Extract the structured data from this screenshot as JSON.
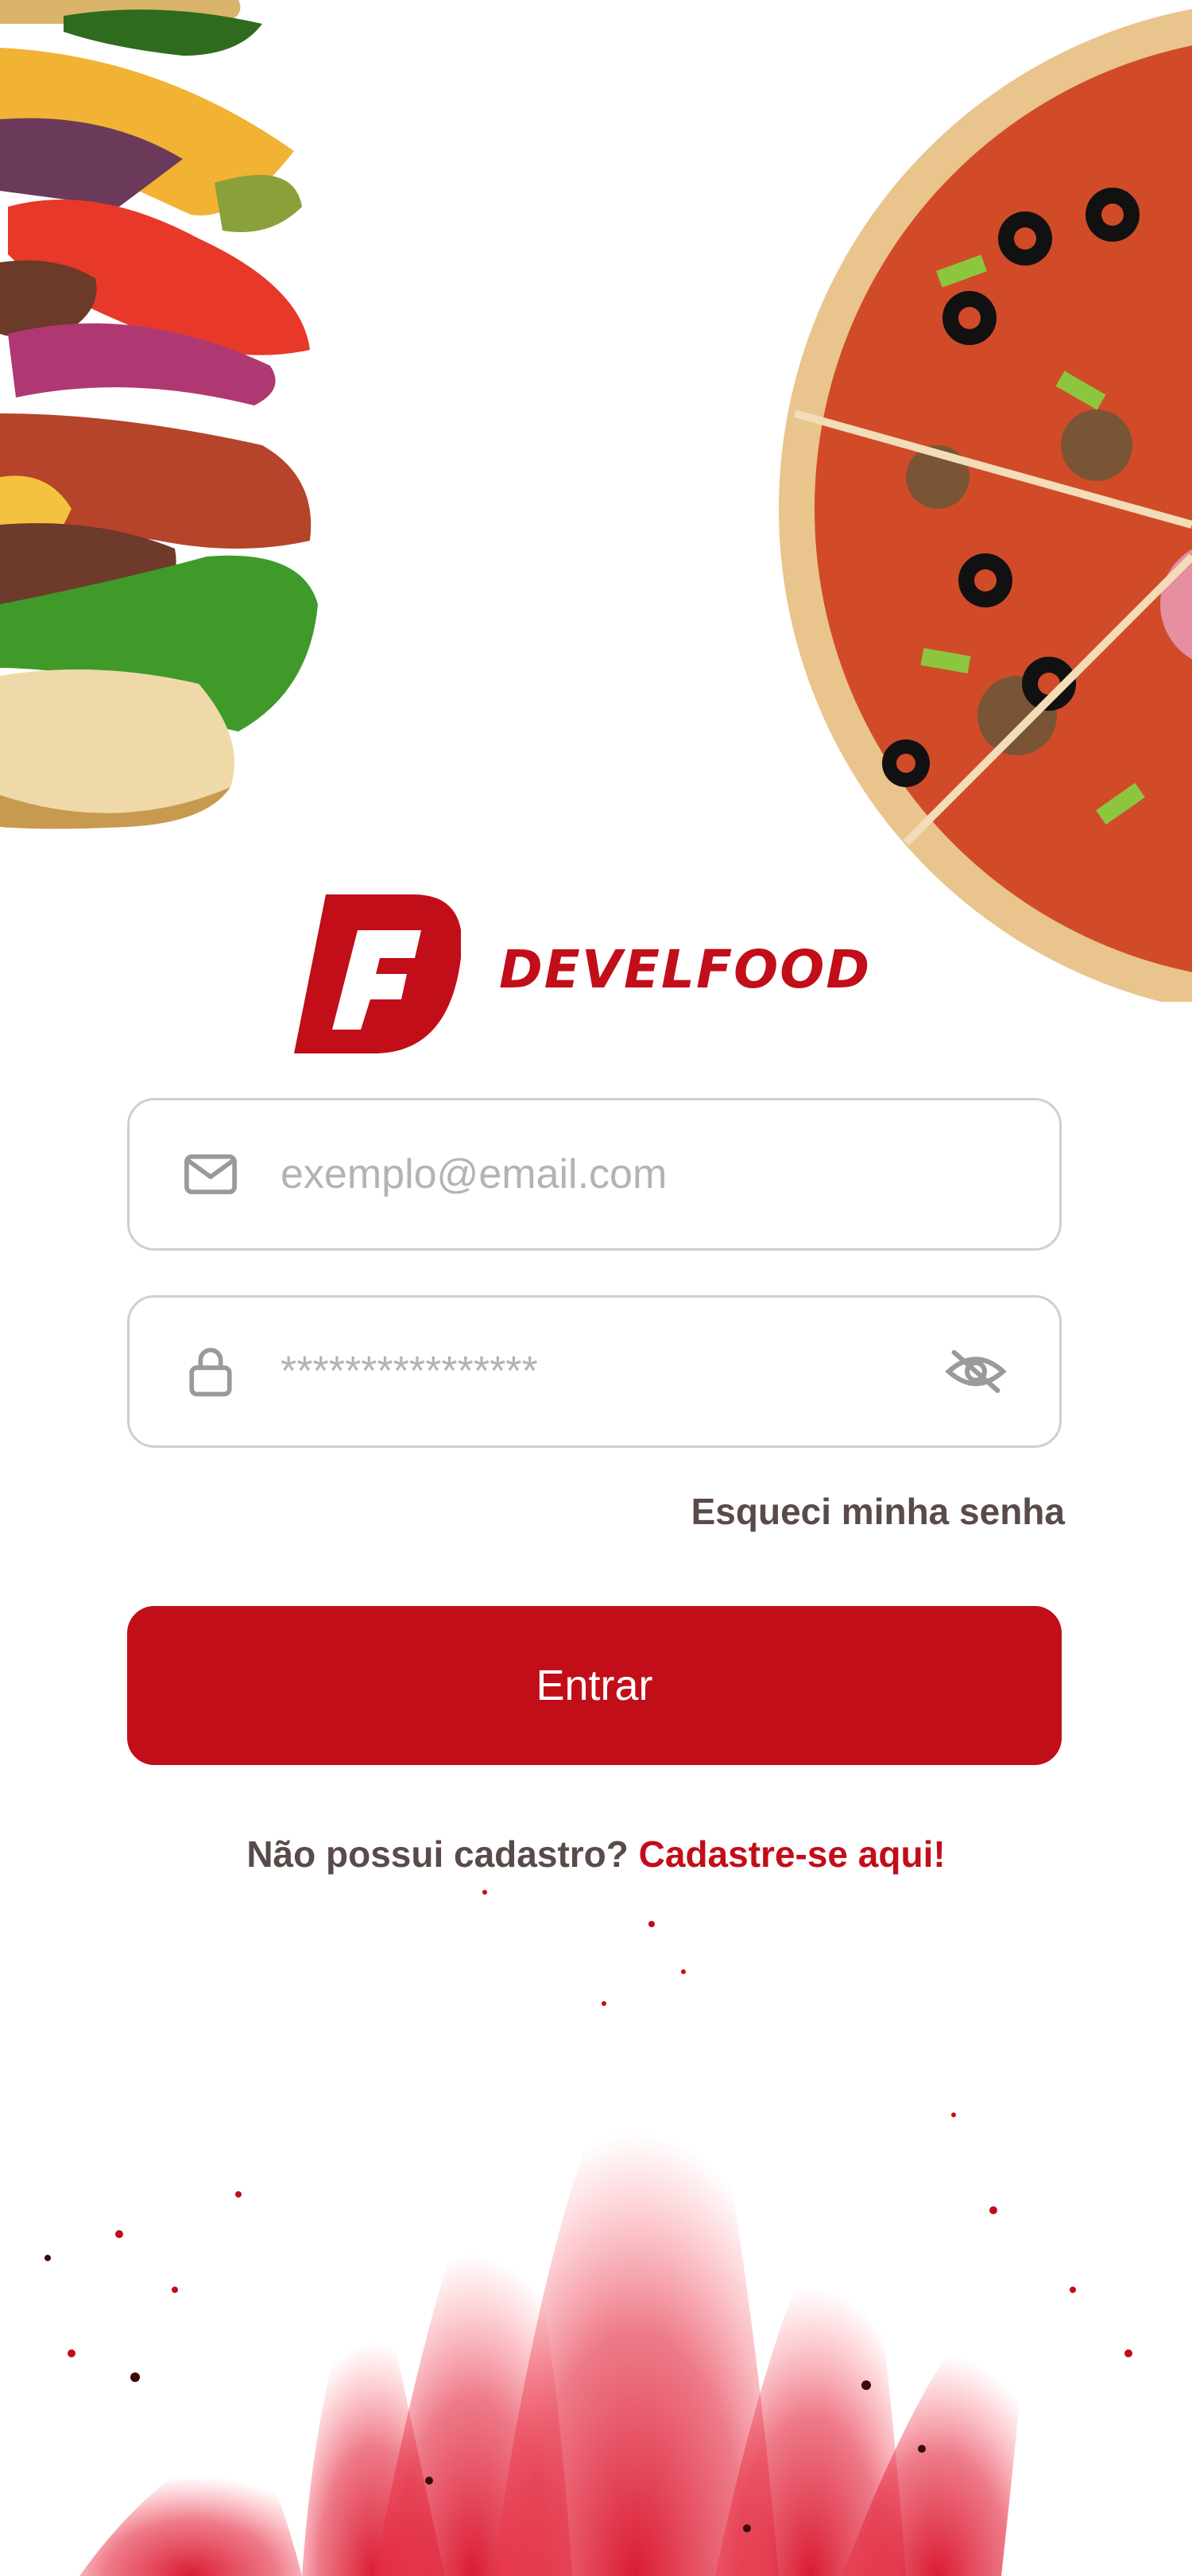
{
  "brand": {
    "name": "DEVELFOOD",
    "mark_letter": "F",
    "color": "#c10e19"
  },
  "login": {
    "email_placeholder": "exemplo@email.com",
    "password_placeholder": "****************",
    "forgot_label": "Esqueci minha senha",
    "submit_label": "Entrar",
    "signup_prompt": "Não possui cadastro?",
    "signup_link": "Cadastre-se aqui!"
  },
  "icons": {
    "email": "mail-icon",
    "password": "lock-icon",
    "visibility": "eye-off-icon"
  }
}
